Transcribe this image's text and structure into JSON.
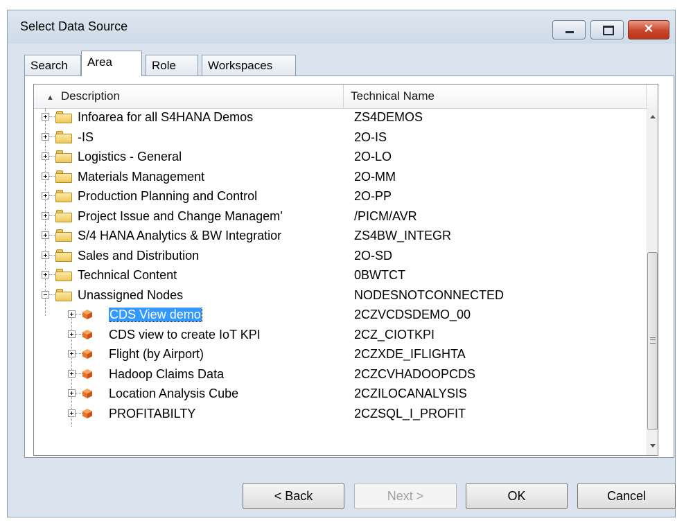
{
  "window": {
    "title": "Select Data Source"
  },
  "tabs": [
    "Search",
    "Area",
    "Role",
    "Workspaces"
  ],
  "columns": {
    "description": "Description",
    "technical_name": "Technical Name"
  },
  "rows": [
    {
      "description": "Infoarea for all S4HANA Demos",
      "technical": "ZS4DEMOS",
      "type": "folder",
      "expanded": false
    },
    {
      "description": "-IS",
      "technical": "2O-IS",
      "type": "folder",
      "expanded": false
    },
    {
      "description": "Logistics - General",
      "technical": "2O-LO",
      "type": "folder",
      "expanded": false
    },
    {
      "description": "Materials Management",
      "technical": "2O-MM",
      "type": "folder",
      "expanded": false
    },
    {
      "description": "Production Planning and Control",
      "technical": "2O-PP",
      "type": "folder",
      "expanded": false
    },
    {
      "description": "Project Issue and Change Managem’",
      "technical": "/PICM/AVR",
      "type": "folder",
      "expanded": false
    },
    {
      "description": "S/4 HANA Analytics & BW Integratior",
      "technical": "ZS4BW_INTEGR",
      "type": "folder",
      "expanded": false
    },
    {
      "description": "Sales and Distribution",
      "technical": "2O-SD",
      "type": "folder",
      "expanded": false
    },
    {
      "description": "Technical Content",
      "technical": "0BWTCT",
      "type": "folder",
      "expanded": false
    },
    {
      "description": "Unassigned Nodes",
      "technical": "NODESNOTCONNECTED",
      "type": "folder",
      "expanded": true
    },
    {
      "description": "CDS View demo",
      "technical": "2CZVCDSDEMO_00",
      "type": "cube",
      "selected": true
    },
    {
      "description": "CDS view to create IoT KPI",
      "technical": "2CZ_CIOTKPI",
      "type": "cube"
    },
    {
      "description": "Flight (by Airport)",
      "technical": "2CZXDE_IFLIGHTA",
      "type": "cube"
    },
    {
      "description": "Hadoop Claims Data",
      "technical": "2CZCVHADOOPCDS",
      "type": "cube"
    },
    {
      "description": "Location Analysis Cube",
      "technical": "2CZILOCANALYSIS",
      "type": "cube"
    },
    {
      "description": "PROFITABILTY",
      "technical": "2CZSQL_I_PROFIT",
      "type": "cube"
    }
  ],
  "buttons": {
    "back": "< Back",
    "next": "Next >",
    "ok": "OK",
    "cancel": "Cancel"
  },
  "icons": {
    "folder": "folder-icon",
    "cube": "cube-icon",
    "sort": "sort-ascending-icon"
  },
  "colors": {
    "selection": "#3399ff",
    "folder": "#eec85b",
    "cube": "#e8742a"
  }
}
